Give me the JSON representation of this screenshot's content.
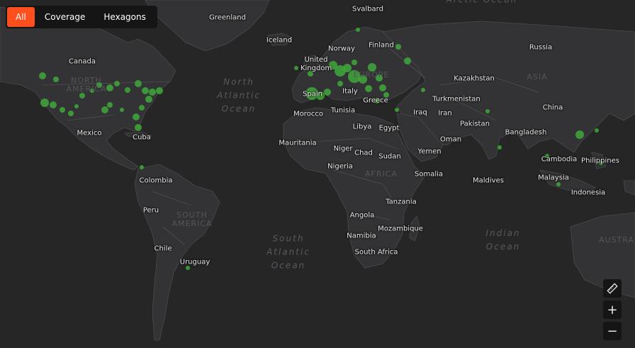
{
  "view_toggle": {
    "options": [
      {
        "label": "All",
        "active": true
      },
      {
        "label": "Coverage",
        "active": false
      },
      {
        "label": "Hexagons",
        "active": false
      }
    ]
  },
  "controls": {
    "measure_icon": "ruler-icon",
    "zoom_in": "+",
    "zoom_out": "−"
  },
  "map": {
    "countries": [
      "Svalbard",
      "Greenland",
      "Iceland",
      "Norway",
      "Finland",
      "Russia",
      "United Kingdom",
      "Canada",
      "Kazakhstan",
      "Spain",
      "Italy",
      "Turkmenistan",
      "Greece",
      "Morocco",
      "Tunisia",
      "Iraq",
      "Iran",
      "China",
      "Mexico",
      "Cuba",
      "Libya",
      "Egypt",
      "Pakistan",
      "Bangladesh",
      "Oman",
      "Mauritania",
      "Niger",
      "Chad",
      "Sudan",
      "Yemen",
      "Nigeria",
      "Somalia",
      "Maldives",
      "Cambodia",
      "Philippines",
      "Colombia",
      "Malaysia",
      "Indonesia",
      "Peru",
      "Tanzania",
      "Angola",
      "Mozambique",
      "Namibia",
      "Chile",
      "South Africa",
      "Uruguay"
    ],
    "continents": [
      "North America",
      "Europe",
      "Asia",
      "Africa",
      "South America",
      "Austra"
    ],
    "oceans": [
      "Arctic Ocean",
      "North Atlantic Ocean",
      "South Atlantic Ocean",
      "Indian Ocean"
    ],
    "colors": {
      "background": "#262626",
      "land": "#333335",
      "coverage": "#3fa83a",
      "accent": "#ff4f1f"
    }
  }
}
